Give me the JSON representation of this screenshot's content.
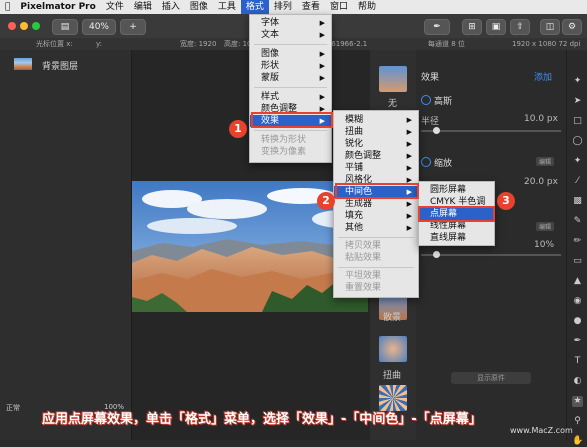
{
  "menubar": {
    "app_name": "Pixelmator Pro",
    "items": [
      "文件",
      "编辑",
      "插入",
      "图像",
      "工具",
      "格式",
      "排列",
      "查看",
      "窗口",
      "帮助"
    ],
    "active": "格式"
  },
  "toolbar": {
    "zoom": "40%",
    "add": "+"
  },
  "infobar": {
    "cursor_x": "光标位置 x:",
    "cursor_y": "y:",
    "width": "宽度: 1920",
    "height": "高度: 1080",
    "profile": "EC61966-2.1",
    "bits": "每通道 8 位",
    "size": "1920 x 1080 72 dpi"
  },
  "layers": {
    "layer_name": "背景图层",
    "blend_mode": "正常",
    "opacity": "100%"
  },
  "format_menu": {
    "items": [
      {
        "label": "字体",
        "arrow": true
      },
      {
        "label": "文本",
        "arrow": true
      },
      {
        "label": "图像",
        "arrow": true
      },
      {
        "label": "形状",
        "arrow": true
      },
      {
        "label": "蒙版",
        "arrow": true
      },
      {
        "label": "样式",
        "arrow": true
      },
      {
        "label": "颜色调整",
        "arrow": true
      },
      {
        "label": "效果",
        "arrow": true
      },
      {
        "label": "转换为形状",
        "arrow": false
      },
      {
        "label": "变换为像素",
        "arrow": false
      }
    ]
  },
  "effects_menu": {
    "items": [
      {
        "label": "模糊"
      },
      {
        "label": "扭曲"
      },
      {
        "label": "锐化"
      },
      {
        "label": "颜色调整"
      },
      {
        "label": "平铺"
      },
      {
        "label": "风格化"
      },
      {
        "label": "中间色"
      },
      {
        "label": "生成器"
      },
      {
        "label": "填充"
      },
      {
        "label": "其他"
      },
      {
        "label": "拷贝效果"
      },
      {
        "label": "粘贴效果"
      },
      {
        "label": "平坦效果"
      },
      {
        "label": "重置效果"
      }
    ]
  },
  "halftone_menu": {
    "items": [
      "圆形屏幕",
      "CMYK 半色调",
      "点屏幕",
      "线性屏幕",
      "直线屏幕"
    ]
  },
  "effects_panel": {
    "title": "效果",
    "add": "添加",
    "gaussian": "高斯",
    "radius_label": "半径",
    "radius_value": "10.0 px",
    "zoom_blur": "缩放",
    "edit": "编辑",
    "amount": "20.0 px",
    "percent": "10%",
    "show_original": "显示原件"
  },
  "strip": {
    "labels": [
      "无",
      "散景",
      "扭曲"
    ]
  },
  "callouts": [
    "1",
    "2",
    "3"
  ],
  "caption": "应用点屏幕效果，单击「格式」菜单，选择「效果」-「中间色」-「点屏幕」",
  "watermark": "www.MacZ.com"
}
